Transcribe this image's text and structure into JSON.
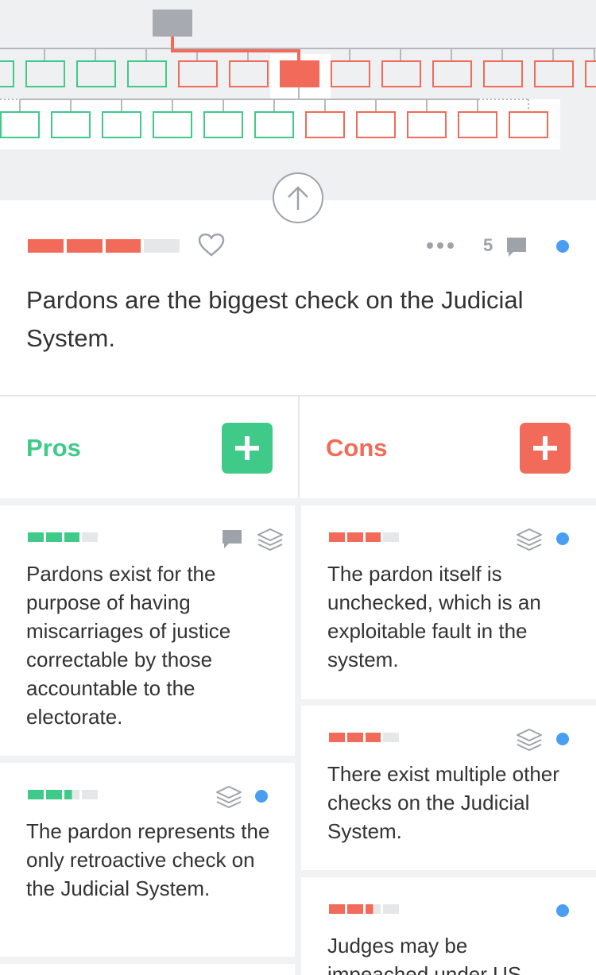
{
  "colors": {
    "accent_green": "#3fca8a",
    "accent_red": "#f26a59",
    "accent_blue": "#4a9ef2",
    "muted": "#9ea3a9"
  },
  "icons": {
    "up": "arrow-up-icon",
    "heart": "heart-icon",
    "more": "more-icon",
    "comment": "comment-icon",
    "layers": "layers-icon",
    "add": "plus-icon"
  },
  "claim": {
    "text": "Pardons are the biggest check on the Judicial System.",
    "comment_count": "5",
    "score_filled": 3,
    "score_total": 4
  },
  "pros": {
    "title": "Pros"
  },
  "cons": {
    "title": "Cons"
  },
  "pro_arguments": [
    {
      "text": "Pardons exist for the purpose of having miscarriages of justice correctable by those accountable to the electorate.",
      "score_filled": 3,
      "score_total": 4
    },
    {
      "text": "The pardon represents the only retroactive check on the Judicial System.",
      "score_filled": 2.5,
      "score_total": 4
    }
  ],
  "con_arguments": [
    {
      "text": "The pardon itself is unchecked, which is an exploitable fault in the system.",
      "score_filled": 3,
      "score_total": 4
    },
    {
      "text": "There exist multiple other checks on the Judicial System.",
      "score_filled": 3,
      "score_total": 4
    },
    {
      "text": "Judges may be impeached under US",
      "score_filled": 2.5,
      "score_total": 4
    }
  ]
}
